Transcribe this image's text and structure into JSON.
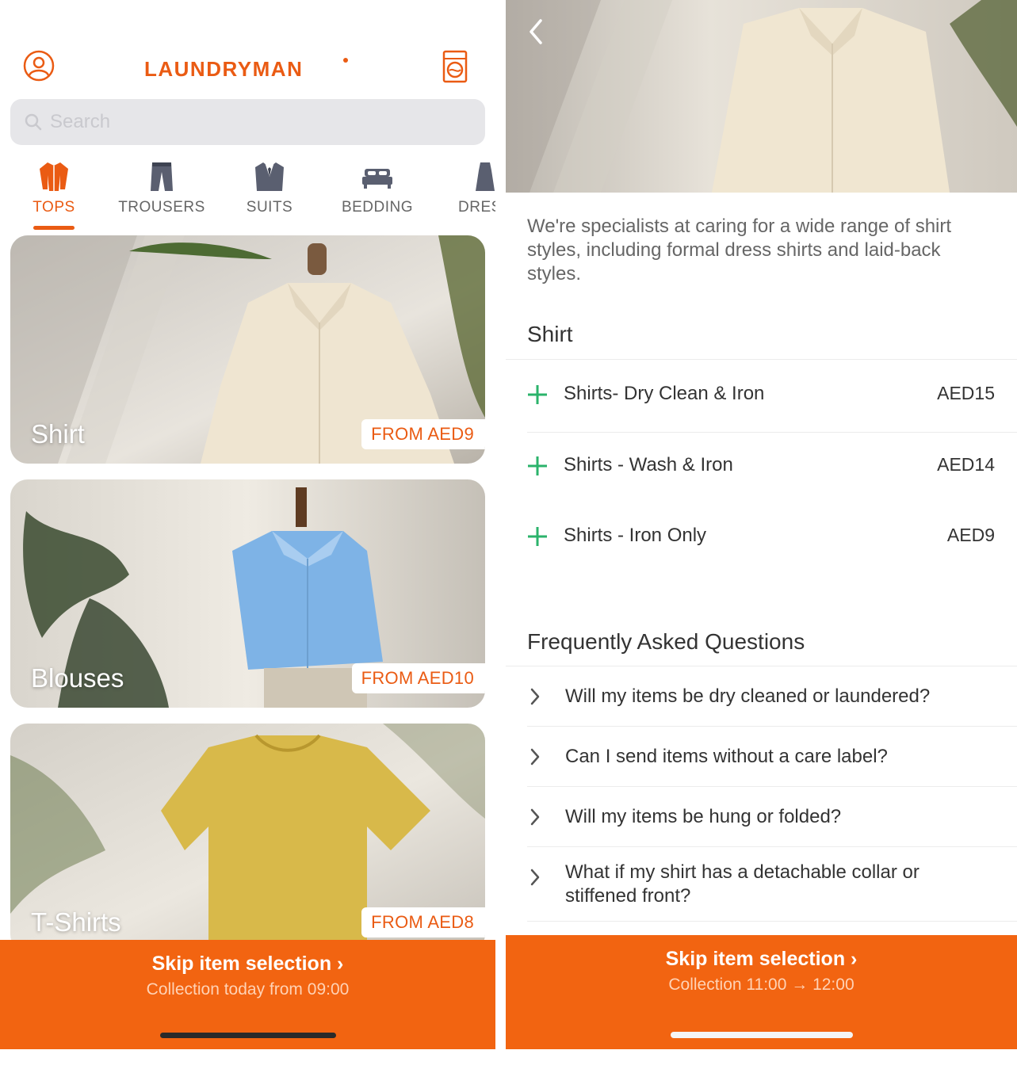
{
  "colors": {
    "accent": "#f26411",
    "accent_text": "#ea5b13",
    "add_green": "#2bb36b"
  },
  "left": {
    "header": {
      "brand": "LAUNDRYMAN",
      "profile_icon": "user-circle-icon",
      "basket_icon": "washing-machine-icon"
    },
    "search": {
      "placeholder": "Search",
      "icon": "search-icon"
    },
    "categories": [
      {
        "label": "TOPS",
        "icon": "shirt-icon",
        "active": true
      },
      {
        "label": "TROUSERS",
        "icon": "trousers-icon",
        "active": false
      },
      {
        "label": "SUITS",
        "icon": "suit-icon",
        "active": false
      },
      {
        "label": "BEDDING",
        "icon": "bed-icon",
        "active": false
      },
      {
        "label": "DRESS",
        "icon": "dress-icon",
        "active": false
      }
    ],
    "cards": [
      {
        "title": "Shirt",
        "price": "FROM AED9"
      },
      {
        "title": "Blouses",
        "price": "FROM AED10"
      },
      {
        "title": "T-Shirts",
        "price": "FROM AED8"
      }
    ],
    "cta": {
      "title": "Skip item selection ›",
      "subtitle": "Collection today from 09:00"
    }
  },
  "right": {
    "back_icon": "chevron-left-icon",
    "intro": "We're specialists at caring for a wide range of shirt styles, including formal dress shirts and laid-back styles.",
    "section_title": "Shirt",
    "services": [
      {
        "name": "Shirts- Dry Clean & Iron",
        "price": "AED15"
      },
      {
        "name": "Shirts - Wash & Iron",
        "price": "AED14"
      },
      {
        "name": "Shirts - Iron Only",
        "price": "AED9"
      }
    ],
    "faq_title": "Frequently Asked Questions",
    "faqs": [
      {
        "q": "Will my items be dry cleaned or laundered?"
      },
      {
        "q": "Can I send items without a care label?"
      },
      {
        "q": "Will my items be hung or folded?"
      },
      {
        "q": "What if my shirt has a detachable collar or stiffened front?"
      }
    ],
    "cta": {
      "title": "Skip item selection ›",
      "subtitle": "Collection 11:00 → 12:00"
    }
  }
}
